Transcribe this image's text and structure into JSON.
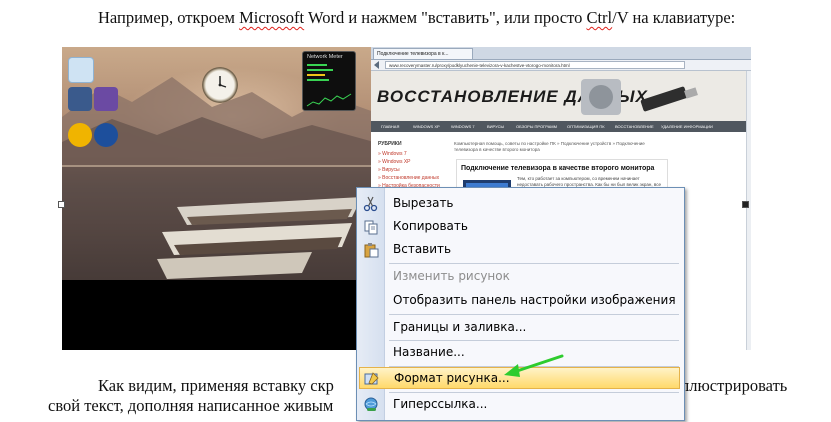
{
  "document": {
    "line1_pre": "Например, откроем ",
    "line1_ms": "Microsoft",
    "line1_mid": " Word и нажмем \"вставить\", или просто ",
    "line1_ctrl": "Ctrl",
    "line1_post": "/V на клавиатуре:",
    "line2": "Как видим, применяя вставку скр",
    "line2_tail": "ллюстрировать",
    "line3": "свой текст, дополняя написанное живым"
  },
  "desktop": {
    "network_meter_title": "Network Meter"
  },
  "browser": {
    "tab_title": "Подключение телевизора в к...",
    "url": "www.recoverymaster.ru/proxy/podklyuchenie-televizora-v-kachestve-vtorogo-monitora.html",
    "site_logo": "ВОССТАНОВЛЕНИЕ ДАННЫХ",
    "nav_items": [
      "ГЛАВНАЯ",
      "WINDOWS XP",
      "WINDOWS 7",
      "ВИРУСЫ",
      "ОБЗОРЫ ПРОГРАММ",
      "ОПТИМИЗАЦИЯ ПК",
      "ВОССТАНОВЛЕНИЕ",
      "УДАЛЕНИЕ ИНФОРМАЦИИ"
    ],
    "sidebar_title": "РУБРИКИ",
    "sidebar_links": [
      "» Windows 7",
      "» Windows XP",
      "» Вирусы",
      "» Восстановление данных",
      "» Настройка безопасности"
    ],
    "breadcrumb": "Компьютерная помощь, советы по настройке ПК » Подключение устройств » Подключение телевизора в качестве второго монитора",
    "article_title": "Подключение телевизора в качестве второго монитора",
    "article_body": "Тем, кто работает за компьютером, со временем начинает недоставать рабочего пространства. Как бы ни был велик экран, все она на нем"
  },
  "context_menu": {
    "items": [
      {
        "label": "Вырезать",
        "icon": "scissors-icon",
        "enabled": true
      },
      {
        "label": "Копировать",
        "icon": "copy-icon",
        "enabled": true
      },
      {
        "label": "Вставить",
        "icon": "paste-icon",
        "enabled": true
      },
      {
        "label": "Изменить рисунок",
        "icon": "",
        "enabled": false
      },
      {
        "label": "Отобразить панель настройки изображения",
        "icon": "",
        "enabled": true
      },
      {
        "label": "Границы и заливка...",
        "icon": "",
        "enabled": true
      },
      {
        "label": "Название...",
        "icon": "",
        "enabled": true
      },
      {
        "label": "Формат рисунка...",
        "icon": "format-picture-icon",
        "enabled": true,
        "highlighted": true
      },
      {
        "label": "Гиперссылка...",
        "icon": "hyperlink-icon",
        "enabled": true
      }
    ]
  },
  "colors": {
    "arrow": "#2ecc2e",
    "highlight": "#ffd96b"
  }
}
